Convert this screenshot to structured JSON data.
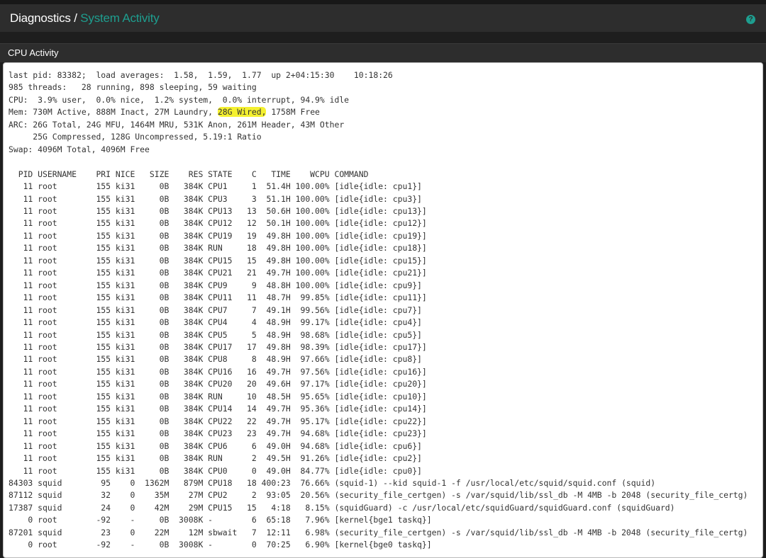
{
  "header": {
    "breadcrumb_parent": "Diagnostics",
    "breadcrumb_sep": " / ",
    "breadcrumb_current": "System Activity",
    "help_icon": "question-circle-icon",
    "accent": "#1e9e8f"
  },
  "panel": {
    "title": "CPU Activity"
  },
  "output": {
    "summary": [
      "last pid: 83382;  load averages:  1.58,  1.59,  1.77  up 2+04:15:30    10:18:26",
      "985 threads:   28 running, 898 sleeping, 59 waiting",
      "CPU:  3.9% user,  0.0% nice,  1.2% system,  0.0% interrupt, 94.9% idle"
    ],
    "mem": {
      "before": "Mem: 730M Active, 888M Inact, 27M Laundry, ",
      "highlight": "28G Wired,",
      "after": " 1758M Free"
    },
    "summary2": [
      "ARC: 26G Total, 24G MFU, 1464M MRU, 531K Anon, 261M Header, 43M Other",
      "     25G Compressed, 128G Uncompressed, 5.19:1 Ratio",
      "Swap: 4096M Total, 4096M Free",
      ""
    ],
    "table_header": "  PID USERNAME    PRI NICE   SIZE    RES STATE    C   TIME    WCPU COMMAND",
    "rows": [
      "   11 root        155 ki31     0B   384K CPU1     1  51.4H 100.00% [idle{idle: cpu1}]",
      "   11 root        155 ki31     0B   384K CPU3     3  51.1H 100.00% [idle{idle: cpu3}]",
      "   11 root        155 ki31     0B   384K CPU13   13  50.6H 100.00% [idle{idle: cpu13}]",
      "   11 root        155 ki31     0B   384K CPU12   12  50.1H 100.00% [idle{idle: cpu12}]",
      "   11 root        155 ki31     0B   384K CPU19   19  49.8H 100.00% [idle{idle: cpu19}]",
      "   11 root        155 ki31     0B   384K RUN     18  49.8H 100.00% [idle{idle: cpu18}]",
      "   11 root        155 ki31     0B   384K CPU15   15  49.8H 100.00% [idle{idle: cpu15}]",
      "   11 root        155 ki31     0B   384K CPU21   21  49.7H 100.00% [idle{idle: cpu21}]",
      "   11 root        155 ki31     0B   384K CPU9     9  48.8H 100.00% [idle{idle: cpu9}]",
      "   11 root        155 ki31     0B   384K CPU11   11  48.7H  99.85% [idle{idle: cpu11}]",
      "   11 root        155 ki31     0B   384K CPU7     7  49.1H  99.56% [idle{idle: cpu7}]",
      "   11 root        155 ki31     0B   384K CPU4     4  48.9H  99.17% [idle{idle: cpu4}]",
      "   11 root        155 ki31     0B   384K CPU5     5  48.9H  98.68% [idle{idle: cpu5}]",
      "   11 root        155 ki31     0B   384K CPU17   17  49.8H  98.39% [idle{idle: cpu17}]",
      "   11 root        155 ki31     0B   384K CPU8     8  48.9H  97.66% [idle{idle: cpu8}]",
      "   11 root        155 ki31     0B   384K CPU16   16  49.7H  97.56% [idle{idle: cpu16}]",
      "   11 root        155 ki31     0B   384K CPU20   20  49.6H  97.17% [idle{idle: cpu20}]",
      "   11 root        155 ki31     0B   384K RUN     10  48.5H  95.65% [idle{idle: cpu10}]",
      "   11 root        155 ki31     0B   384K CPU14   14  49.7H  95.36% [idle{idle: cpu14}]",
      "   11 root        155 ki31     0B   384K CPU22   22  49.7H  95.17% [idle{idle: cpu22}]",
      "   11 root        155 ki31     0B   384K CPU23   23  49.7H  94.68% [idle{idle: cpu23}]",
      "   11 root        155 ki31     0B   384K CPU6     6  49.0H  94.68% [idle{idle: cpu6}]",
      "   11 root        155 ki31     0B   384K RUN      2  49.5H  91.26% [idle{idle: cpu2}]",
      "   11 root        155 ki31     0B   384K CPU0     0  49.0H  84.77% [idle{idle: cpu0}]",
      "84303 squid        95    0  1362M   879M CPU18   18 400:23  76.66% (squid-1) --kid squid-1 -f /usr/local/etc/squid/squid.conf (squid)",
      "87112 squid        32    0    35M    27M CPU2     2  93:05  20.56% (security_file_certgen) -s /var/squid/lib/ssl_db -M 4MB -b 2048 (security_file_certg)",
      "17387 squid        24    0    42M    29M CPU15   15   4:18   8.15% (squidGuard) -c /usr/local/etc/squidGuard/squidGuard.conf (squidGuard)",
      "    0 root        -92    -     0B  3008K -        6  65:18   7.96% [kernel{bge1 taskq}]",
      "87201 squid        23    0    22M    12M sbwait   7  12:11   6.98% (security_file_certgen) -s /var/squid/lib/ssl_db -M 4MB -b 2048 (security_file_certg)",
      "    0 root        -92    -     0B  3008K -        0  70:25   6.90% [kernel{bge0 taskq}]"
    ]
  }
}
